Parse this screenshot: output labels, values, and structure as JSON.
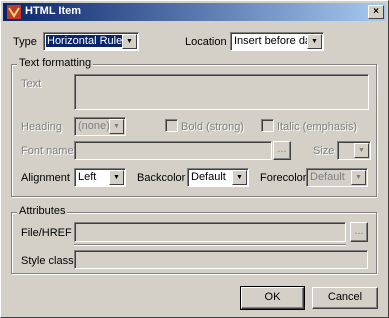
{
  "window": {
    "title": "HTML Item",
    "close_glyph": "×"
  },
  "top": {
    "type_label": "Type",
    "type_value": "Horizontal Rule",
    "location_label": "Location",
    "location_value": "Insert before data"
  },
  "text_formatting": {
    "group_label": "Text formatting",
    "text_label": "Text",
    "heading_label": "Heading",
    "heading_value": "(none)",
    "bold_label": "Bold (strong)",
    "italic_label": "Italic (emphasis)",
    "font_name_label": "Font name",
    "browse_label": "...",
    "size_label": "Size",
    "size_value": "",
    "alignment_label": "Alignment",
    "alignment_value": "Left",
    "backcolor_label": "Backcolor",
    "backcolor_value": "Default",
    "forecolor_label": "Forecolor",
    "forecolor_value": "Default"
  },
  "attributes": {
    "group_label": "Attributes",
    "file_href_label": "File/HREF",
    "browse_label": "...",
    "style_class_label": "Style class"
  },
  "buttons": {
    "ok_label": "OK",
    "cancel_label": "Cancel"
  },
  "colors": {
    "title_gradient_start": "#0a246a",
    "title_gradient_end": "#a6caf0",
    "face": "#d4d0c8"
  }
}
